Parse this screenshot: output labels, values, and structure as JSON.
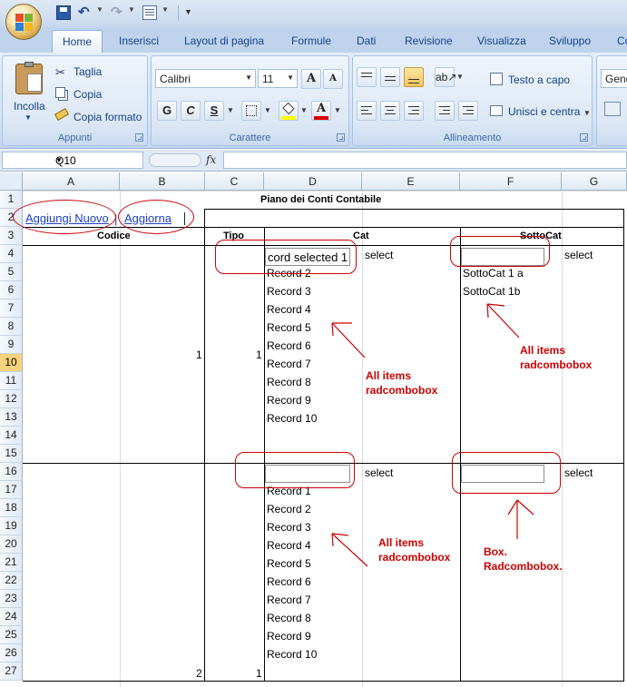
{
  "ribbon_tabs": [
    "Home",
    "Inserisci",
    "Layout di pagina",
    "Formule",
    "Dati",
    "Revisione",
    "Visualizza",
    "Sviluppo",
    "Co"
  ],
  "clipboard": {
    "paste": "Incolla",
    "cut": "Taglia",
    "copy": "Copia",
    "format_painter": "Copia formato",
    "group": "Appunti"
  },
  "font": {
    "name": "Calibri",
    "size": "11",
    "bold": "G",
    "italic": "C",
    "underline": "S",
    "grow": "A",
    "shrink": "A",
    "color_letter": "A",
    "group": "Carattere"
  },
  "alignment": {
    "wrap": "Testo a capo",
    "merge": "Unisci e centra",
    "group": "Allineamento"
  },
  "number": {
    "format": "Gene"
  },
  "formula_bar": {
    "name_box": "Q10",
    "fx": "fx",
    "value": ""
  },
  "columns": [
    "A",
    "B",
    "C",
    "D",
    "E",
    "F",
    "G"
  ],
  "rows": [
    "1",
    "2",
    "3",
    "4",
    "5",
    "6",
    "7",
    "8",
    "9",
    "10",
    "11",
    "12",
    "13",
    "14",
    "15",
    "16",
    "17",
    "18",
    "19",
    "20",
    "21",
    "22",
    "23",
    "24",
    "25",
    "26",
    "27"
  ],
  "selected_row": "10",
  "sheet": {
    "title": "Piano dei Conti Contabile",
    "links": {
      "add_new": "Aggiungi Nuovo",
      "refresh": "Aggiorna"
    },
    "headers": {
      "codice": "Codice",
      "tipo": "Tipo",
      "cat": "Cat",
      "sottocat": "SottoCat"
    },
    "record1": {
      "codice": "1",
      "tipo": "1",
      "cat_combo_value": "cord selected 1",
      "cat_select": "select",
      "cat_items": [
        "Record 2",
        "Record 3",
        "Record 4",
        "Record 5",
        "Record 6",
        "Record 7",
        "Record 8",
        "Record 9",
        "Record 10"
      ],
      "subcat_combo_value": "",
      "subcat_select": "select",
      "subcat_items": [
        "SottoCat 1 a",
        "SottoCat 1b"
      ]
    },
    "record2": {
      "codice": "2",
      "tipo": "1",
      "cat_combo_value": "",
      "cat_select": "select",
      "cat_items": [
        "Record 1",
        "Record 2",
        "Record 3",
        "Record 4",
        "Record 5",
        "Record 6",
        "Record 7",
        "Record 8",
        "Record 9",
        "Record 10"
      ],
      "subcat_combo_value": "",
      "subcat_select": "select"
    }
  },
  "annotations": {
    "note1_line1": "All items",
    "note1_line2": "radcombobox",
    "note2_line1": "All items",
    "note2_line2": "radcombobox",
    "note3_line1": "All items",
    "note3_line2": "radcombobox",
    "note4_line1": "Box.",
    "note4_line2": "Radcombobox."
  },
  "colors": {
    "annotation": "#cc0000",
    "link": "#1a3fc4",
    "selected_row_header": "#f8d37c",
    "ribbon": "#d6e4f5"
  }
}
